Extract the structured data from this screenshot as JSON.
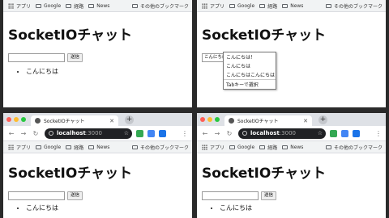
{
  "bookmarks": {
    "apps": "アプリ",
    "items": [
      "Google",
      "経路",
      "News"
    ],
    "other": "その他のブックマーク"
  },
  "page": {
    "title": "SocketIOチャット",
    "send_label": "送信",
    "message": "こんにちは"
  },
  "autocomplete": {
    "input_value": "こんにちは！こんにちは",
    "options": [
      "こんにちは！",
      "こんにちは",
      "こんにちはこんにちは"
    ],
    "hint": "Tabキーで選択"
  },
  "browser": {
    "tab_title": "SocketIOチャット",
    "url_host": "localhost",
    "url_port": ":3000"
  },
  "colors": {
    "traffic_red": "#ff5f57",
    "traffic_yellow": "#febc2e",
    "traffic_green": "#28c840"
  }
}
